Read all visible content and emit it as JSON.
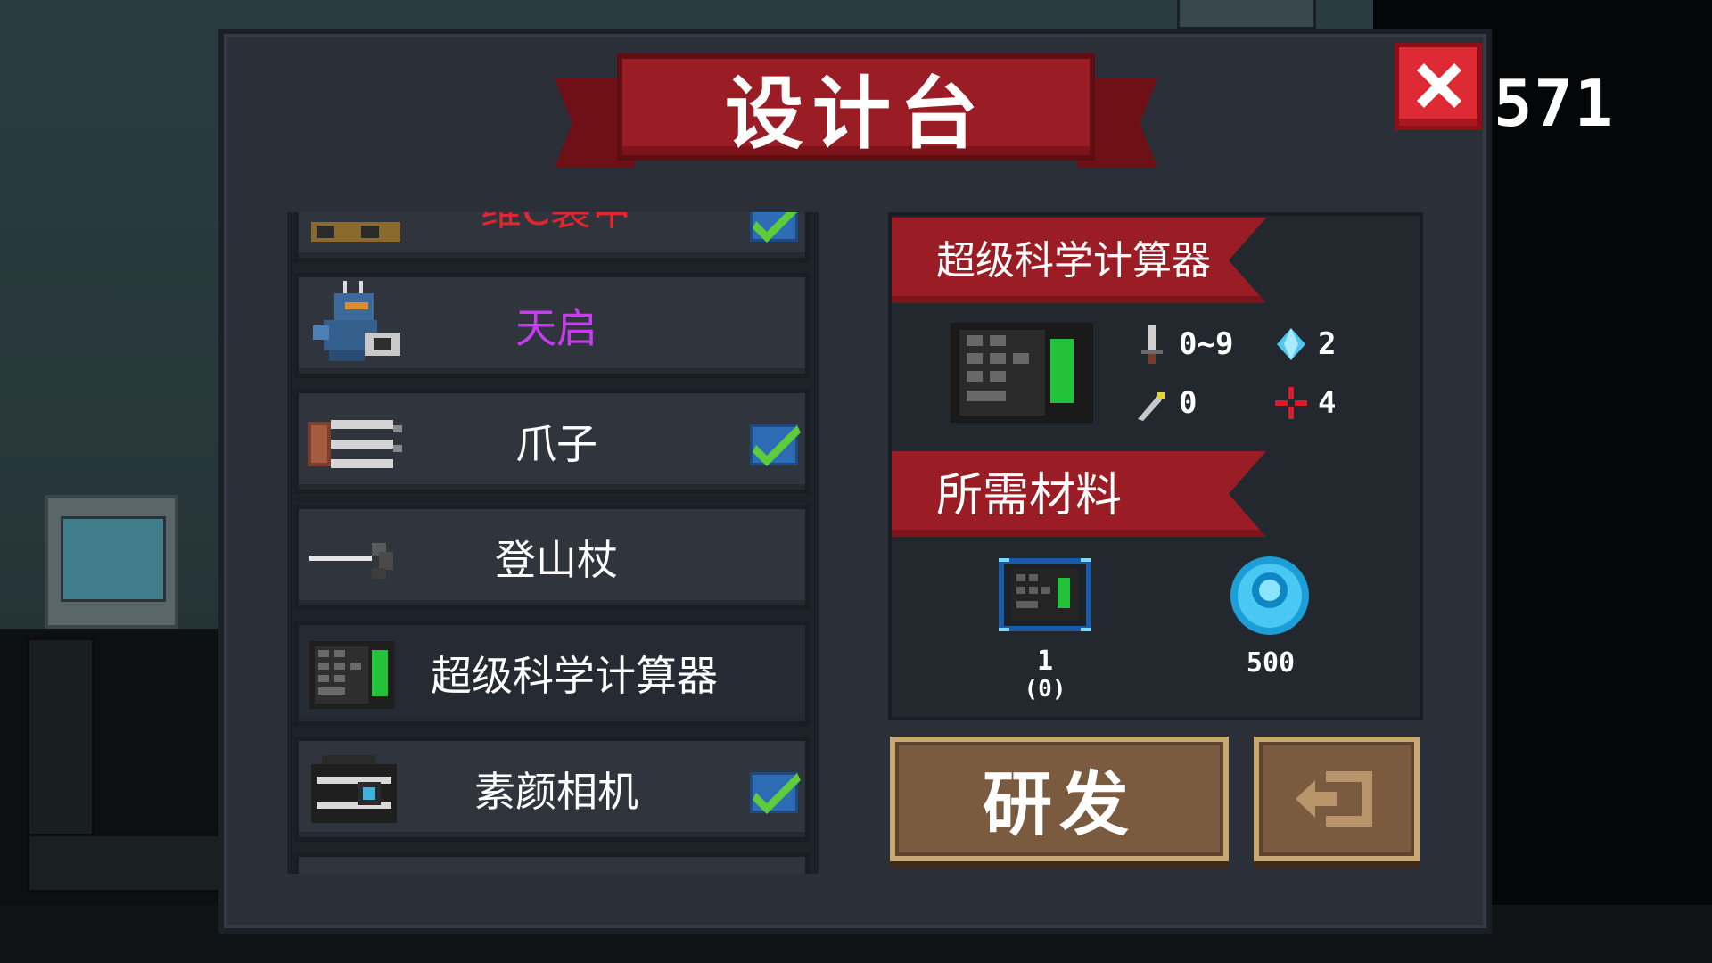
{
  "hud": {
    "score_partial": "571"
  },
  "dialog": {
    "title": "设计台",
    "close_icon": "close-x-icon"
  },
  "list": {
    "items": [
      {
        "label": "维C装甲",
        "label_color": "#e0262e",
        "checked": true,
        "icon": "weapon-icon",
        "partial": true
      },
      {
        "label": "天启",
        "label_color": "#c83cf0",
        "checked": false,
        "icon": "armored-knight-icon"
      },
      {
        "label": "爪子",
        "label_color": "#ffffff",
        "checked": true,
        "icon": "claw-icon"
      },
      {
        "label": "登山杖",
        "label_color": "#ffffff",
        "checked": false,
        "icon": "hiking-stick-icon"
      },
      {
        "label": "超级科学计算器",
        "label_color": "#ffffff",
        "checked": false,
        "icon": "calculator-icon",
        "selected": true
      },
      {
        "label": "素颜相机",
        "label_color": "#ffffff",
        "checked": true,
        "icon": "camera-icon"
      }
    ]
  },
  "detail": {
    "item_name": "超级科学计算器",
    "stats": {
      "damage": "0~9",
      "energy_cost": "2",
      "crit": "0",
      "accuracy": "4"
    },
    "materials_header": "所需材料",
    "materials": [
      {
        "icon": "calculator-blueprint-icon",
        "count": "1",
        "owned": "(0)"
      },
      {
        "icon": "gem-coin-icon",
        "count": "500"
      }
    ]
  },
  "actions": {
    "develop_label": "研发",
    "exit_icon": "exit-arrow-icon"
  }
}
